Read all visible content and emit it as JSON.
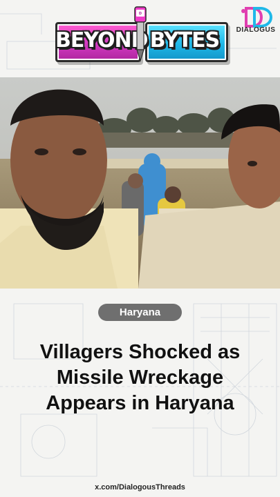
{
  "brand": {
    "logo_word_left": "BEYOND",
    "logo_word_right": "BYTES",
    "pen_badge": "DIALOGUS",
    "publisher": "DIALOGUS",
    "colors": {
      "pink": "#d23ac2",
      "cyan": "#1fb8e8",
      "tag_bg": "#6f6f6f"
    }
  },
  "tag": {
    "label": "Haryana"
  },
  "headline": {
    "lines": [
      "Villagers Shocked as",
      "Missile Wreckage",
      "Appears in Haryana"
    ]
  },
  "footer": {
    "handle": "x.com/DialogousThreads"
  }
}
